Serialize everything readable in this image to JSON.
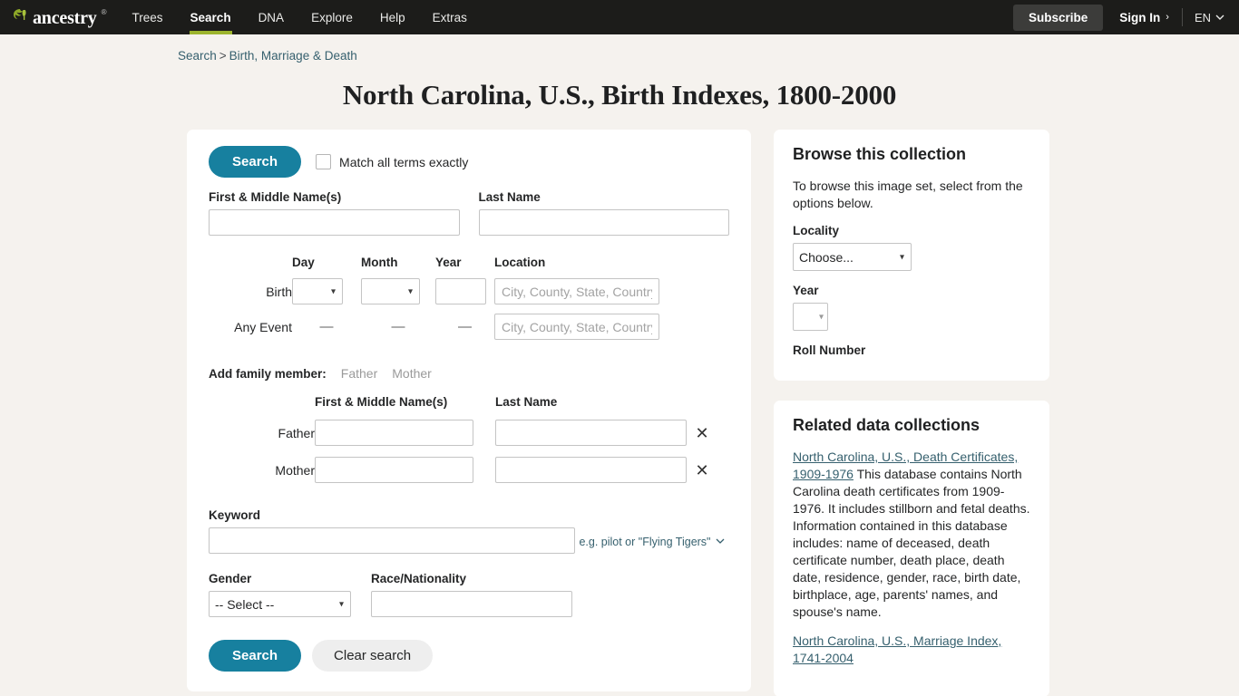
{
  "header": {
    "brand": "ancestry",
    "brand_icon": "leaf-icon",
    "nav": [
      {
        "label": "Trees",
        "active": false
      },
      {
        "label": "Search",
        "active": true
      },
      {
        "label": "DNA",
        "active": false
      },
      {
        "label": "Explore",
        "active": false
      },
      {
        "label": "Help",
        "active": false
      },
      {
        "label": "Extras",
        "active": false
      }
    ],
    "subscribe_label": "Subscribe",
    "signin_label": "Sign In",
    "signin_chevron": "›",
    "language": "EN",
    "language_chevron": "⌄",
    "accent_green": "#9cb42d",
    "bar_bg": "#1c1c1a"
  },
  "breadcrumb": {
    "root": "Search",
    "separator": ">",
    "current": "Birth, Marriage & Death"
  },
  "page_title": "North Carolina, U.S., Birth Indexes, 1800-2000",
  "form": {
    "search_top_label": "Search",
    "match_exact_label": "Match all terms exactly",
    "first_name_label": "First & Middle Name(s)",
    "first_name_value": "",
    "last_name_label": "Last Name",
    "last_name_value": "",
    "date_headers": {
      "day": "Day",
      "month": "Month",
      "year": "Year",
      "location": "Location"
    },
    "birth_row_label": "Birth",
    "any_event_row_label": "Any Event",
    "dash": "—",
    "day_value": "",
    "month_value": "",
    "year_value": "",
    "location_placeholder": "City, County, State, Country",
    "birth_location_value": "",
    "any_event_location_value": "",
    "add_family_label": "Add family member:",
    "add_family_options": [
      "Father",
      "Mother"
    ],
    "family_headers": {
      "first": "First & Middle Name(s)",
      "last": "Last Name"
    },
    "father_label": "Father",
    "mother_label": "Mother",
    "father_first_value": "",
    "father_last_value": "",
    "mother_first_value": "",
    "mother_last_value": "",
    "remove_icon": "✕",
    "keyword_label": "Keyword",
    "keyword_value": "",
    "keyword_hint": "e.g. pilot or \"Flying Tigers\"",
    "keyword_hint_chevron": "⌄",
    "gender_label": "Gender",
    "gender_value": "-- Select --",
    "race_label": "Race/Nationality",
    "race_value": "",
    "search_button": "Search",
    "clear_button": "Clear search",
    "accent_teal": "#17809f"
  },
  "browse": {
    "title": "Browse this collection",
    "intro": "To browse this image set, select from the options below.",
    "locality_label": "Locality",
    "locality_value": "Choose...",
    "year_label": "Year",
    "year_value": "",
    "roll_label": "Roll Number"
  },
  "related": {
    "title": "Related data collections",
    "items": [
      {
        "link": "North Carolina, U.S., Death Certificates, 1909-1976",
        "description": "This database contains North Carolina death certificates from 1909-1976. It includes stillborn and fetal deaths. Information contained in this database includes: name of deceased, death certificate number, death place, death date, residence, gender, race, birth date, birthplace, age, parents' names, and spouse's name."
      },
      {
        "link": "North Carolina, U.S., Marriage Index, 1741-2004",
        "description": ""
      }
    ],
    "link_color": "#36606e"
  }
}
